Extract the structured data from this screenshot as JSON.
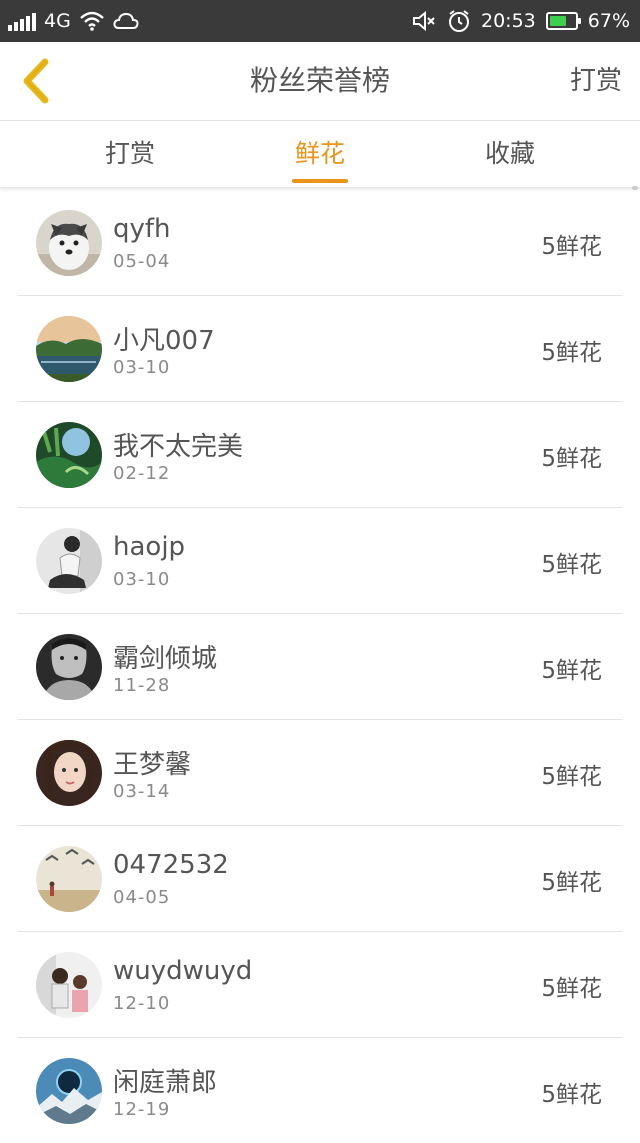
{
  "status_bar": {
    "network": "4G",
    "time": "20:53",
    "battery_text": "67%",
    "battery_level": 0.67,
    "battery_color": "#3ecf4f"
  },
  "header": {
    "title": "粉丝荣誉榜",
    "action": "打赏",
    "back_icon": "chevron-left-icon",
    "back_color": "#e8b91a"
  },
  "tabs": [
    {
      "label": "打赏",
      "active": false
    },
    {
      "label": "鲜花",
      "active": true
    },
    {
      "label": "收藏",
      "active": false
    }
  ],
  "accent_color": "#e8951a",
  "fans": [
    {
      "name": "qyfh",
      "date": "05-04",
      "count": "5鲜花"
    },
    {
      "name": "小凡007",
      "date": "03-10",
      "count": "5鲜花"
    },
    {
      "name": "我不太完美",
      "date": "02-12",
      "count": "5鲜花"
    },
    {
      "name": "haojp",
      "date": "03-10",
      "count": "5鲜花"
    },
    {
      "name": "霸剑倾城",
      "date": "11-28",
      "count": "5鲜花"
    },
    {
      "name": "王梦馨",
      "date": "03-14",
      "count": "5鲜花"
    },
    {
      "name": "0472532",
      "date": "04-05",
      "count": "5鲜花"
    },
    {
      "name": "wuydwuyd",
      "date": "12-10",
      "count": "5鲜花"
    },
    {
      "name": "闲庭萧郎",
      "date": "12-19",
      "count": "5鲜花"
    }
  ]
}
